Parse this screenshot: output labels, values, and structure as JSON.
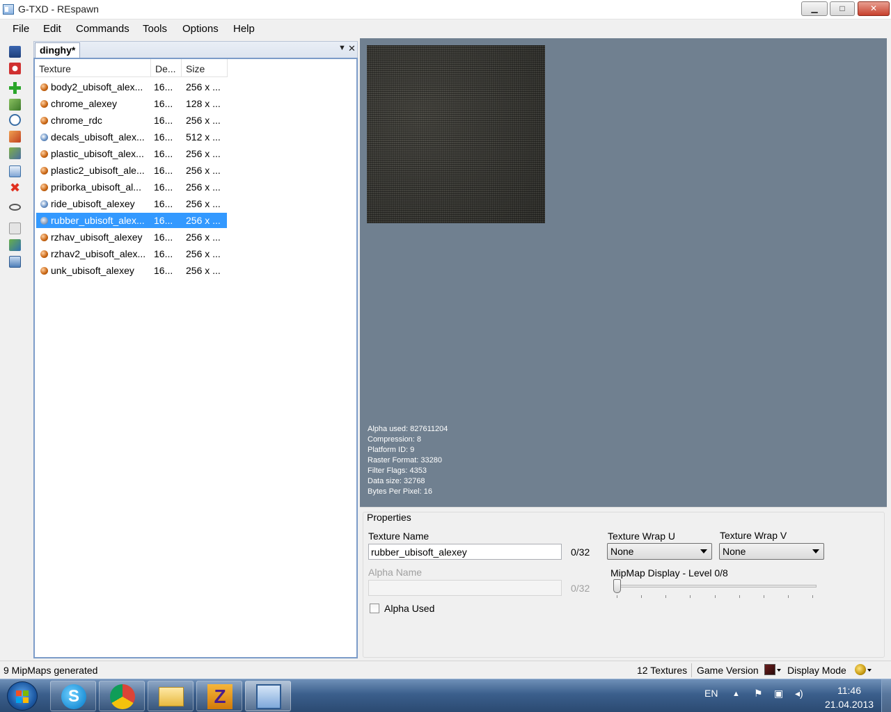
{
  "window": {
    "title": "G-TXD - REspawn"
  },
  "menu": [
    "File",
    "Edit",
    "Commands",
    "Tools",
    "Options",
    "Help"
  ],
  "document": {
    "tab_label": "dinghy*",
    "columns": [
      "Texture",
      "De...",
      "Size"
    ],
    "rows": [
      {
        "name": "body2_ubisoft_alex...",
        "depth": "16...",
        "size": "256 x ...",
        "icon": "orange"
      },
      {
        "name": "chrome_alexey",
        "depth": "16...",
        "size": "128 x ...",
        "icon": "orange"
      },
      {
        "name": "chrome_rdc",
        "depth": "16...",
        "size": "256 x ...",
        "icon": "orange"
      },
      {
        "name": "decals_ubisoft_alex...",
        "depth": "16...",
        "size": "512 x ...",
        "icon": "blue"
      },
      {
        "name": "plastic_ubisoft_alex...",
        "depth": "16...",
        "size": "256 x ...",
        "icon": "orange"
      },
      {
        "name": "plastic2_ubisoft_ale...",
        "depth": "16...",
        "size": "256 x ...",
        "icon": "orange"
      },
      {
        "name": "priborka_ubisoft_al...",
        "depth": "16...",
        "size": "256 x ...",
        "icon": "orange"
      },
      {
        "name": "ride_ubisoft_alexey",
        "depth": "16...",
        "size": "256 x ...",
        "icon": "blue"
      },
      {
        "name": "rubber_ubisoft_alex...",
        "depth": "16...",
        "size": "256 x ...",
        "icon": "grey",
        "selected": true
      },
      {
        "name": "rzhav_ubisoft_alexey",
        "depth": "16...",
        "size": "256 x ...",
        "icon": "orange"
      },
      {
        "name": "rzhav2_ubisoft_alex...",
        "depth": "16...",
        "size": "256 x ...",
        "icon": "orange"
      },
      {
        "name": "unk_ubisoft_alexey",
        "depth": "16...",
        "size": "256 x ...",
        "icon": "orange"
      }
    ]
  },
  "preview": {
    "info": [
      "Alpha used: 827611204",
      "Compression: 8",
      "Platform ID: 9",
      "Raster Format: 33280",
      "Filter Flags: 4353",
      "Data size: 32768",
      "Bytes Per Pixel: 16"
    ]
  },
  "properties": {
    "group_title": "Properties",
    "texture_name_label": "Texture Name",
    "texture_name_value": "rubber_ubisoft_alexey",
    "texture_name_count": "0/32",
    "alpha_name_label": "Alpha Name",
    "alpha_name_value": "",
    "alpha_name_count": "0/32",
    "alpha_used_label": "Alpha Used",
    "wrap_u_label": "Texture Wrap U",
    "wrap_u_value": "None",
    "wrap_v_label": "Texture Wrap V",
    "wrap_v_value": "None",
    "mipmap_label": "MipMap Display - Level 0/8",
    "mipmap_level": 0,
    "mipmap_max": 8
  },
  "status": {
    "left": "9 MipMaps generated",
    "textures": "12 Textures",
    "game_version": "Game Version",
    "display_mode": "Display Mode"
  },
  "taskbar": {
    "lang": "EN",
    "time": "11:46",
    "date": "21.04.2013"
  },
  "toolbar_icons": [
    "save-icon",
    "export-icon",
    "add-icon",
    "import-icon",
    "timer-icon",
    "replace-icon",
    "tool-icon",
    "rename-icon",
    "delete-icon",
    "view-icon",
    "properties-icon",
    "convert-icon",
    "image-icon"
  ]
}
